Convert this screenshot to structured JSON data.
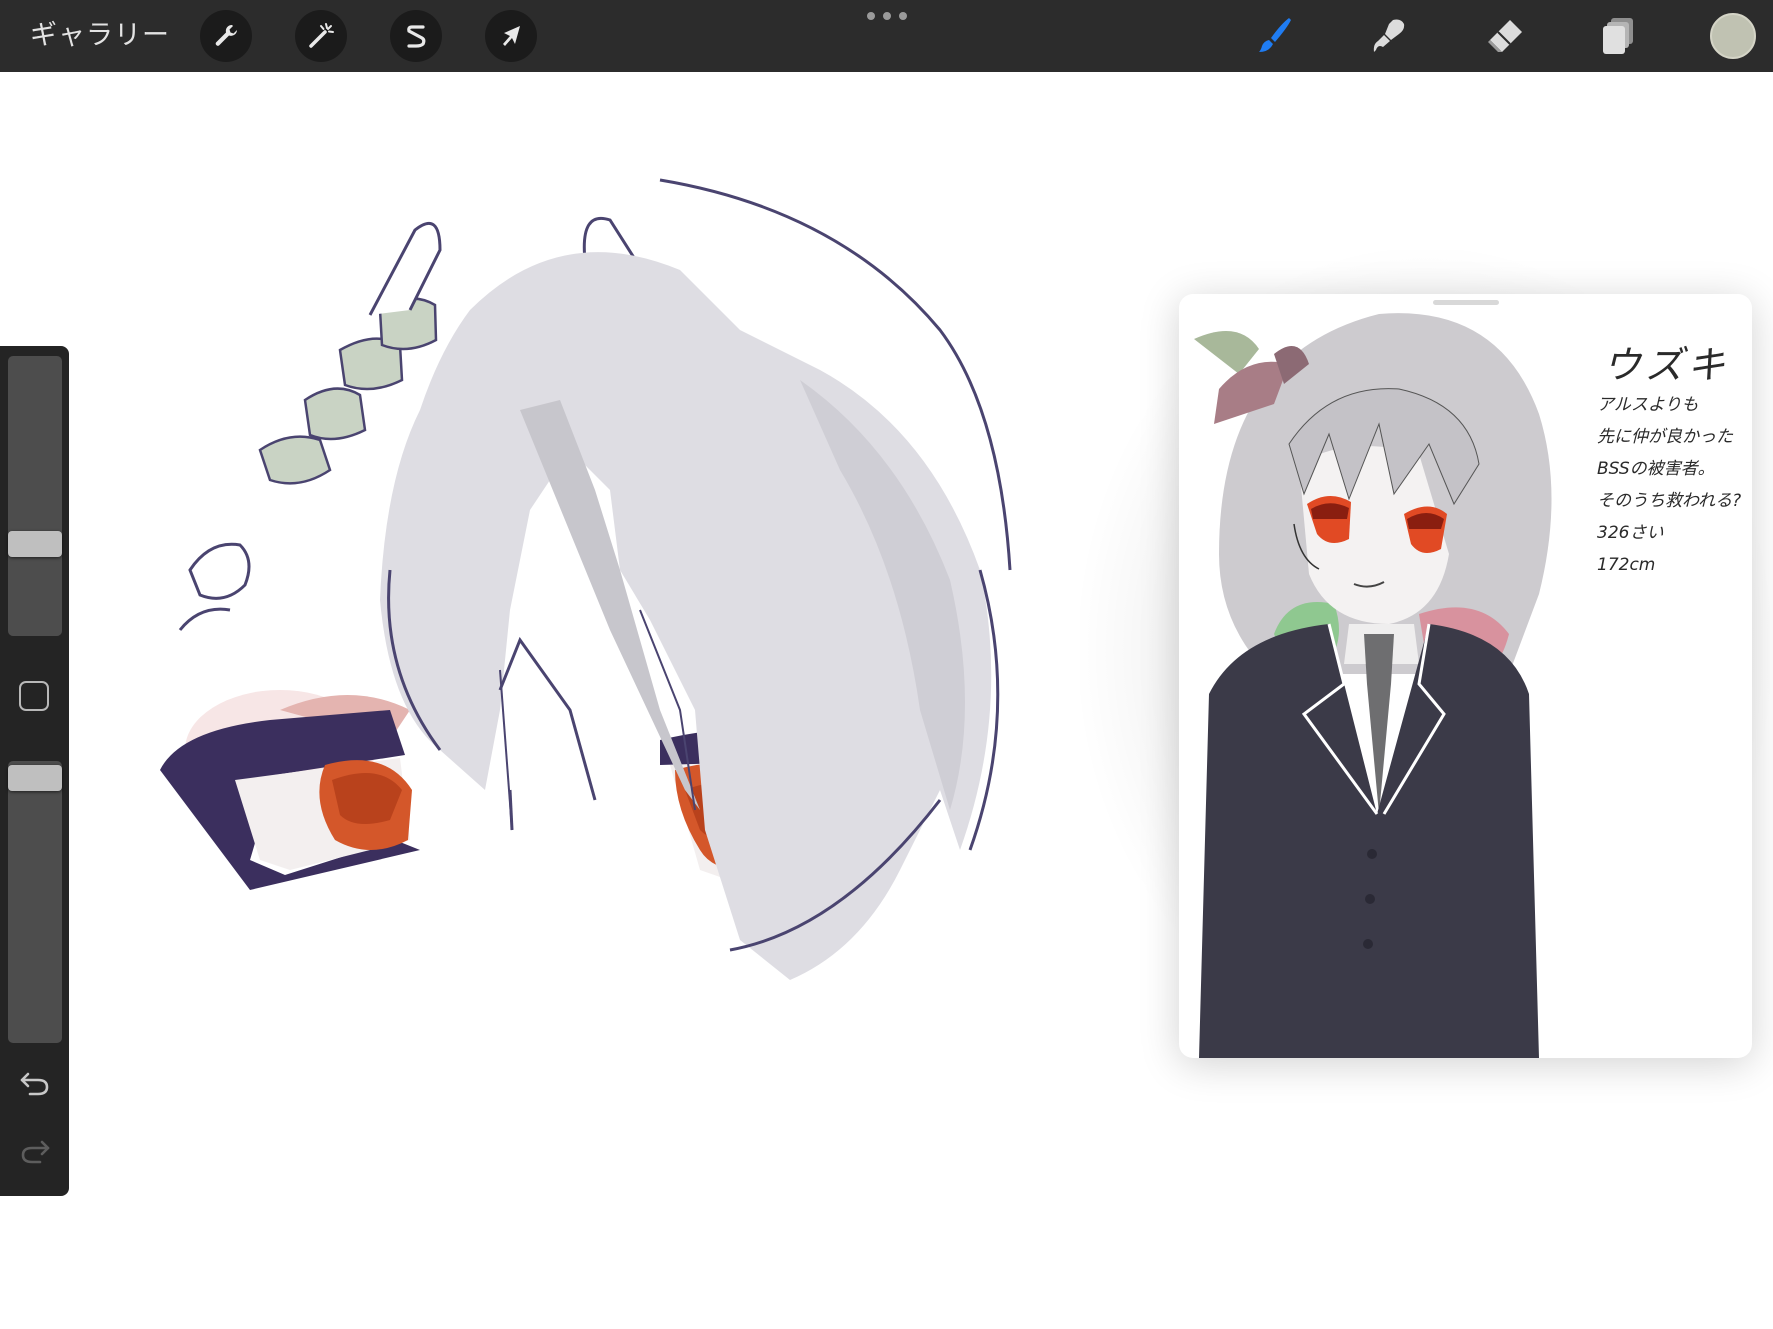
{
  "toolbar": {
    "gallery_label": "ギャラリー",
    "left_tools": [
      {
        "name": "actions",
        "icon": "wrench-icon"
      },
      {
        "name": "adjustments",
        "icon": "magic-wand-icon"
      },
      {
        "name": "selection",
        "icon": "selection-s-icon"
      },
      {
        "name": "transform",
        "icon": "arrow-cursor-icon"
      }
    ],
    "more_icon": "ellipsis-icon",
    "right_tools": [
      {
        "name": "brush",
        "icon": "brush-icon",
        "active": true
      },
      {
        "name": "smudge",
        "icon": "smudge-icon"
      },
      {
        "name": "eraser",
        "icon": "eraser-icon"
      },
      {
        "name": "layers",
        "icon": "layers-icon"
      }
    ],
    "current_color": "#c0c2b2",
    "active_color": "#1f7cf2"
  },
  "sidebar": {
    "brush_size_level": 0.65,
    "opacity_level": 0.95,
    "modify_icon": "square-modify-icon",
    "undo_icon": "undo-icon",
    "redo_icon": "redo-icon"
  },
  "reference": {
    "notes": {
      "name": "ウズキ",
      "lines": [
        "アルスよりも",
        "先に仲が良かった",
        "BSSの被害者。",
        "そのうち救われる?",
        "326さい",
        "172cm"
      ]
    }
  }
}
